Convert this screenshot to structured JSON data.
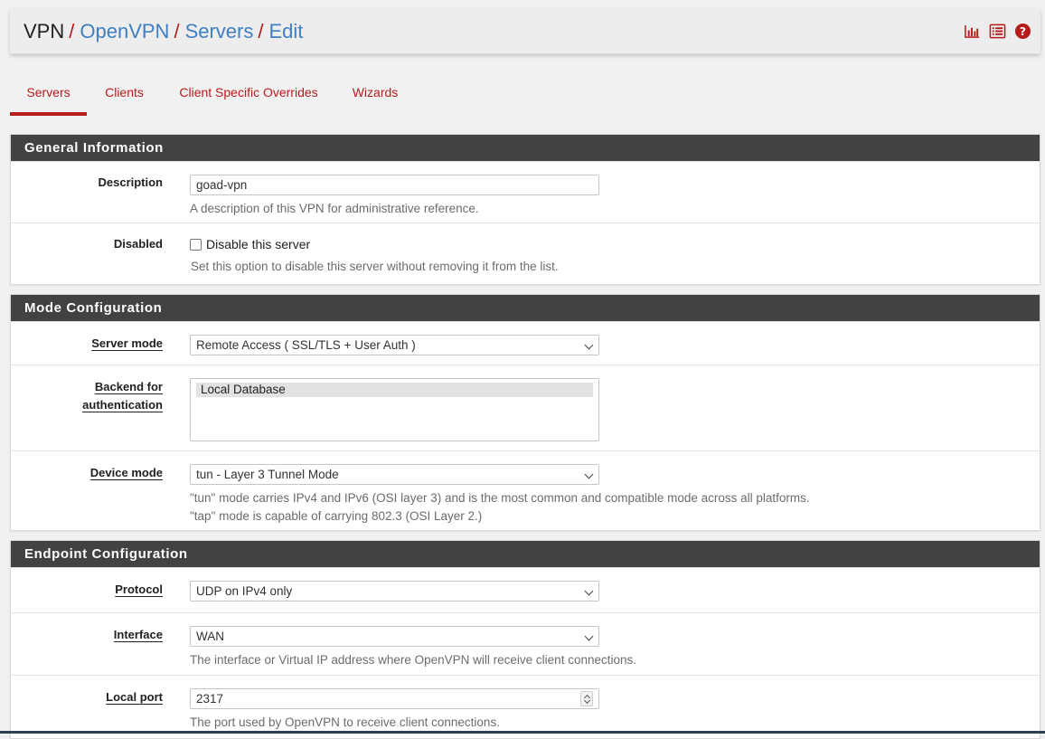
{
  "breadcrumb": {
    "items": [
      "VPN",
      "OpenVPN",
      "Servers",
      "Edit"
    ],
    "separator": "/"
  },
  "header_icons": [
    "bar-chart-icon",
    "list-icon",
    "help-icon"
  ],
  "tabs": [
    {
      "label": "Servers",
      "active": true
    },
    {
      "label": "Clients",
      "active": false
    },
    {
      "label": "Client Specific Overrides",
      "active": false
    },
    {
      "label": "Wizards",
      "active": false
    }
  ],
  "general": {
    "title": "General Information",
    "description": {
      "label": "Description",
      "value": "goad-vpn",
      "help": "A description of this VPN for administrative reference."
    },
    "disabled": {
      "label": "Disabled",
      "checkbox_label": "Disable this server",
      "checked": false,
      "help": "Set this option to disable this server without removing it from the list."
    }
  },
  "mode": {
    "title": "Mode Configuration",
    "server_mode": {
      "label": "Server mode",
      "value": "Remote Access ( SSL/TLS + User Auth )"
    },
    "backend": {
      "label_line1": "Backend for",
      "label_line2": "authentication",
      "options": [
        "Local Database"
      ]
    },
    "device_mode": {
      "label": "Device mode",
      "value": "tun - Layer 3 Tunnel Mode",
      "help1": "\"tun\" mode carries IPv4 and IPv6 (OSI layer 3) and is the most common and compatible mode across all platforms.",
      "help2": "\"tap\" mode is capable of carrying 802.3 (OSI Layer 2.)"
    }
  },
  "endpoint": {
    "title": "Endpoint Configuration",
    "protocol": {
      "label": "Protocol",
      "value": "UDP on IPv4 only"
    },
    "interface": {
      "label": "Interface",
      "value": "WAN",
      "help": "The interface or Virtual IP address where OpenVPN will receive client connections."
    },
    "local_port": {
      "label": "Local port",
      "value": "2317",
      "help": "The port used by OpenVPN to receive client connections."
    }
  },
  "colors": {
    "accent": "#b71c1c",
    "link": "#3f7fbf",
    "panel_heading": "#424242"
  }
}
